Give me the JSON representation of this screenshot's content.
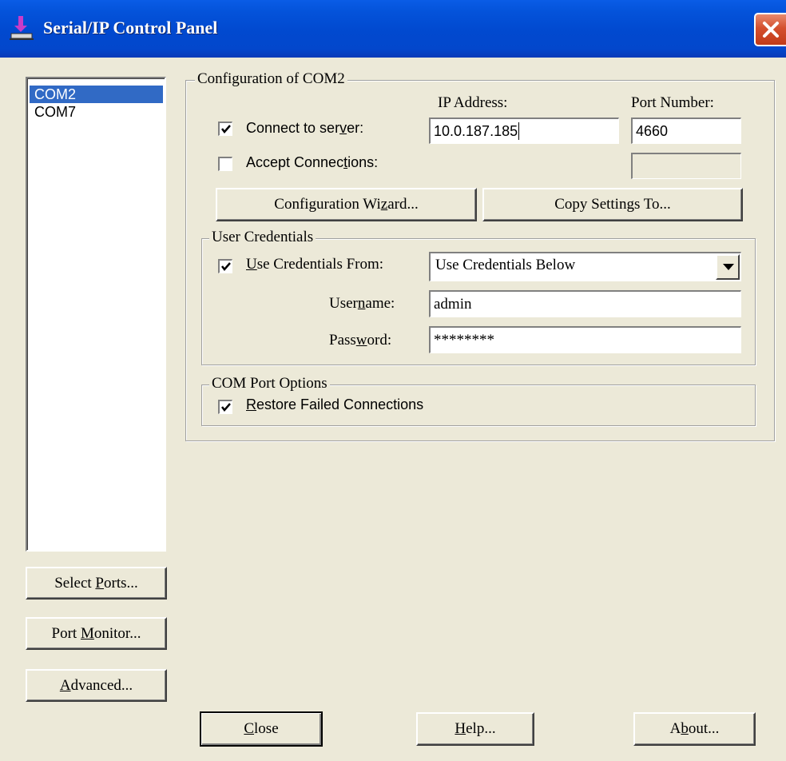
{
  "window": {
    "title": "Serial/IP Control Panel"
  },
  "ports": [
    {
      "name": "COM2",
      "selected": true
    },
    {
      "name": "COM7",
      "selected": false
    }
  ],
  "side_buttons": {
    "select_ports": {
      "pre": "Select ",
      "key": "P",
      "post": "orts..."
    },
    "port_monitor": {
      "pre": "Port ",
      "key": "M",
      "post": "onitor..."
    },
    "advanced": {
      "pre": "",
      "key": "A",
      "post": "dvanced..."
    }
  },
  "config": {
    "group_label": "Configuration of COM2",
    "ip_header": "IP Address:",
    "port_header": "Port Number:",
    "connect": {
      "checked": true,
      "pre": "Connect to ser",
      "key": "v",
      "post": "er:",
      "ip": "10.0.187.185",
      "port": "4660"
    },
    "accept": {
      "checked": false,
      "pre": "Accept Connec",
      "key": "t",
      "post": "ions:",
      "port": ""
    },
    "wizard_button": {
      "pre": "Configuration Wi",
      "key": "z",
      "post": "ard..."
    },
    "copy_button": "Copy Settings To..."
  },
  "credentials": {
    "group_label": "User Credentials",
    "use_from": {
      "checked": true,
      "pre": "",
      "key": "U",
      "post": "se Credentials From:"
    },
    "source_value": "Use Credentials Below",
    "username_label": {
      "pre": "User",
      "key": "n",
      "post": "ame:"
    },
    "username": "admin",
    "password_label": {
      "pre": "Pass",
      "key": "w",
      "post": "ord:"
    },
    "password": "********"
  },
  "options": {
    "group_label": "COM Port Options",
    "restore": {
      "checked": true,
      "pre": "",
      "key": "R",
      "post": "estore Failed Connections"
    }
  },
  "bottom_buttons": {
    "close": {
      "pre": "",
      "key": "C",
      "post": "lose"
    },
    "help": {
      "pre": "",
      "key": "H",
      "post": "elp..."
    },
    "about": {
      "pre": "A",
      "key": "b",
      "post": "out..."
    }
  }
}
